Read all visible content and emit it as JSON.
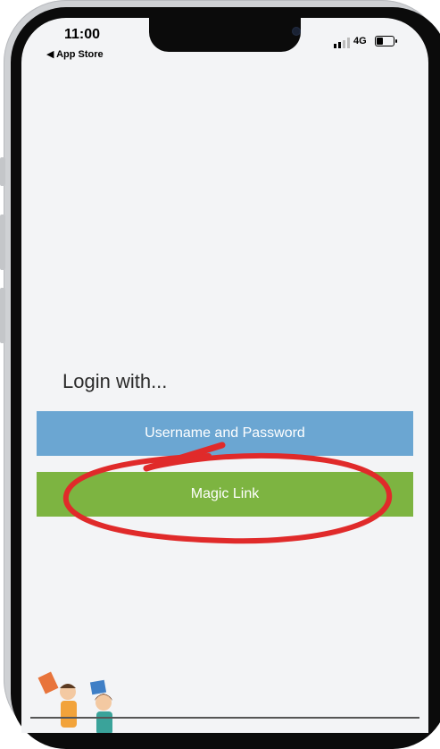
{
  "status_bar": {
    "time": "11:00",
    "back_label": "◀ App Store",
    "network": "4G",
    "battery_level": 0.35
  },
  "login": {
    "title": "Login with...",
    "username_password_label": "Username and Password",
    "magic_link_label": "Magic Link"
  },
  "colors": {
    "username_password_button": "#6ba6d2",
    "magic_link_button": "#7db441",
    "annotation_circle": "#e02a2a"
  }
}
